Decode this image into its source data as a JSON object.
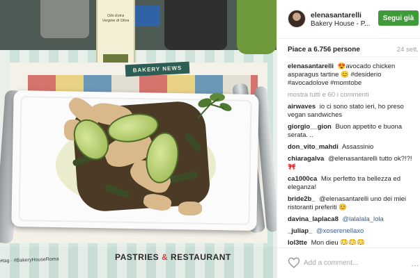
{
  "photo": {
    "bottle_label": "Olio Extra Vergine di Oliva",
    "banner": "BAKERY NEWS",
    "mat_footer_left": "PASTRIES",
    "mat_footer_amp": "&",
    "mat_footer_right": "RESTAURANT",
    "mat_hashtag": "#tag · #BakeryHouseRoma"
  },
  "header": {
    "username": "elenasantarelli",
    "location": "Bakery House - P...",
    "follow_label": "Segui già"
  },
  "stats": {
    "likes": "Piace a 6.756 persone",
    "date": "24 sett."
  },
  "caption": {
    "user": "elenasantarelli",
    "text": "😍avocado chicken asparagus tartine 😊 #desiderio #avocadolove #momtobe"
  },
  "more_comments": "mostra tutti e 60 i commenti",
  "comments": [
    {
      "user": "airwaves",
      "text": "io ci sono stato ieri, ho preso vegan sandwiches"
    },
    {
      "user": "giorgio__gion",
      "text": "Buon appetito e buona serata. .."
    },
    {
      "user": "don_vito_mahdi",
      "text": "Assassinio"
    },
    {
      "user": "chiaragalva",
      "text": "@elenasantarelli tutto ok?!?! 🎀"
    },
    {
      "user": "ca1000ca",
      "text": "Mix perfetto tra bellezza ed eleganza!"
    },
    {
      "user": "bride2b_",
      "text": "@elenasantarelli uno dei miei ristoranti preferiti 😊"
    },
    {
      "user": "davina_laplaca8",
      "text": "@lalalala_lola"
    },
    {
      "user": "_juliap_",
      "text": "@xoserenellaxo"
    },
    {
      "user": "lol3tte",
      "text": "Mon dieu 😳😳😳"
    }
  ],
  "comment_box": {
    "placeholder": "Add a comment...",
    "options_glyph": "…"
  }
}
